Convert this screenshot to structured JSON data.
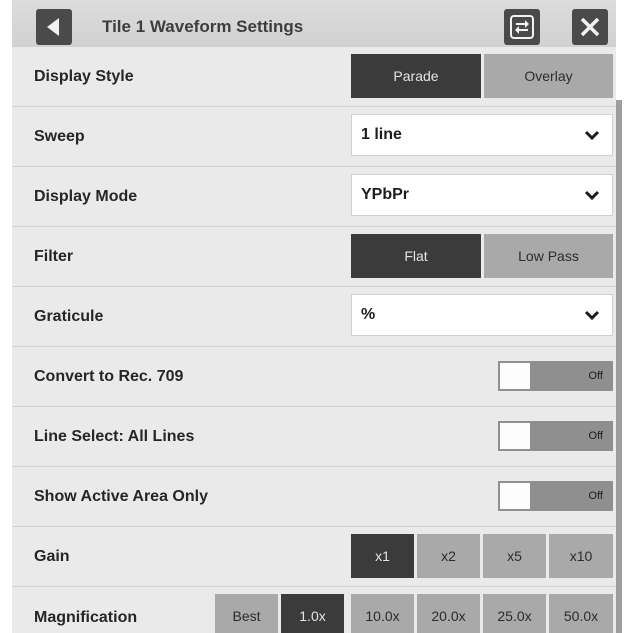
{
  "header": {
    "title": "Tile 1 Waveform Settings"
  },
  "rows": {
    "display_style": {
      "label": "Display Style",
      "options": [
        "Parade",
        "Overlay"
      ],
      "selected": "Parade"
    },
    "sweep": {
      "label": "Sweep",
      "value": "1 line"
    },
    "display_mode": {
      "label": "Display Mode",
      "value": "YPbPr"
    },
    "filter": {
      "label": "Filter",
      "options": [
        "Flat",
        "Low Pass"
      ],
      "selected": "Flat"
    },
    "graticule": {
      "label": "Graticule",
      "value": "%"
    },
    "convert": {
      "label": "Convert to Rec. 709",
      "toggle": "Off"
    },
    "line_select": {
      "label": "Line Select: All Lines",
      "toggle": "Off"
    },
    "active_area": {
      "label": "Show Active Area Only",
      "toggle": "Off"
    },
    "gain": {
      "label": "Gain",
      "options": [
        "x1",
        "x2",
        "x5",
        "x10"
      ],
      "selected": "x1"
    },
    "magnification": {
      "label": "Magnification",
      "options": [
        "Best",
        "1.0x",
        "10.0x",
        "20.0x",
        "25.0x",
        "50.0x"
      ],
      "selected": "1.0x"
    }
  },
  "icons": {
    "back": "back-arrow-icon",
    "swap": "swap-arrows-icon",
    "close": "close-icon",
    "dropdown": "chevron-down-icon"
  },
  "colors": {
    "header": "#d4d4d4",
    "active_segment": "#3b3b3b",
    "inactive_segment": "#a9a9a9",
    "toggle_track": "#8f8f8f"
  }
}
